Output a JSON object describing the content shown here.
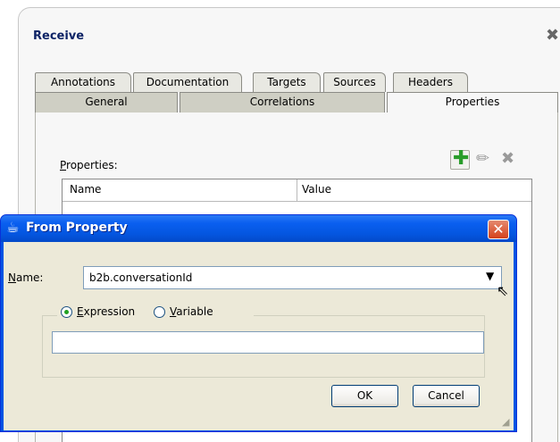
{
  "receive": {
    "title": "Receive",
    "close_icon": "close-x-icon",
    "tabs_row1": [
      "Annotations",
      "Documentation",
      "Targets",
      "Sources",
      "Headers"
    ],
    "tabs_row2": [
      "General",
      "Correlations",
      "Properties"
    ],
    "active_tab": "Properties",
    "properties_label_prefix": "P",
    "properties_label_rest": "roperties:",
    "columns": [
      "Name",
      "Value"
    ]
  },
  "dialog": {
    "title": "From Property",
    "name_label_prefix": "N",
    "name_label_rest": "ame:",
    "name_value": "b2b.conversationId",
    "radio_expression_prefix": "E",
    "radio_expression_rest": "xpression",
    "radio_variable_prefix": "V",
    "radio_variable_rest": "ariable",
    "selected_radio": "Expression",
    "expression_value": "",
    "ok_label": "OK",
    "cancel_label": "Cancel"
  },
  "colors": {
    "title_text": "#0e2466",
    "xp_title_blue": "#0a5ff0",
    "xp_close_red": "#d5411c",
    "dialog_body": "#ece9d8",
    "add_green": "#2a9d2a"
  }
}
